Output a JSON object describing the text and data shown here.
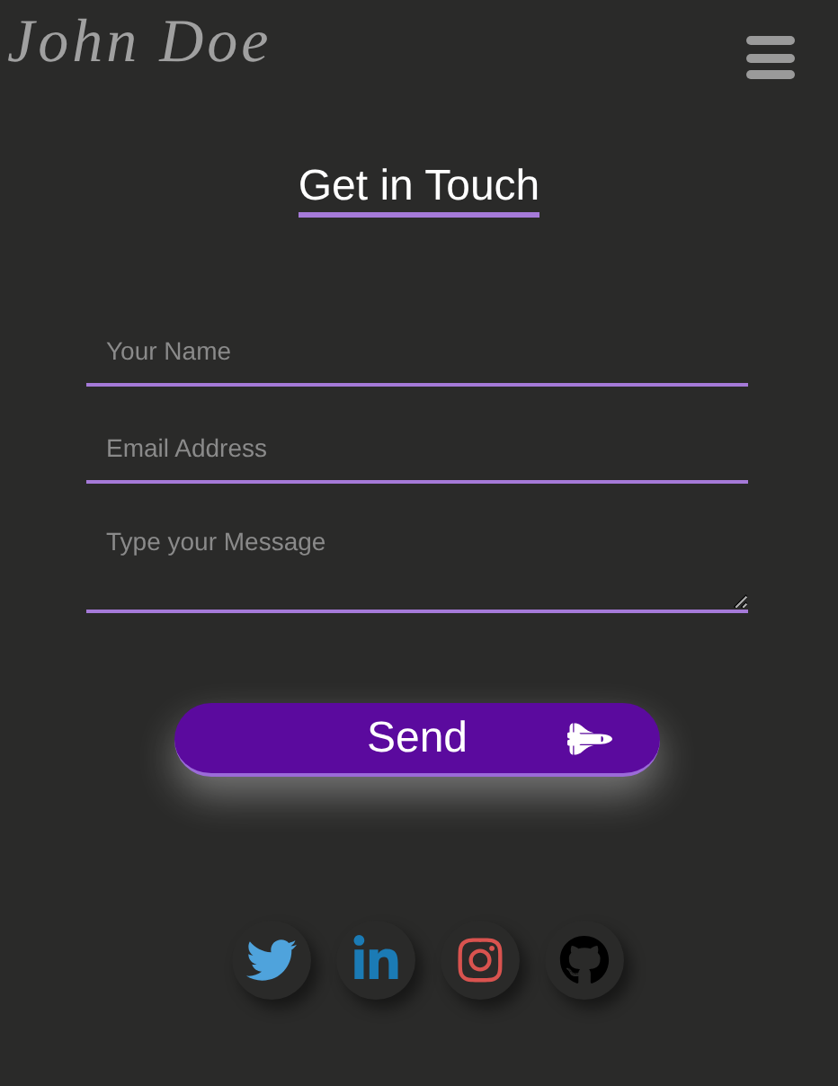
{
  "header": {
    "logo": "John Doe"
  },
  "title": "Get in Touch",
  "form": {
    "fields": [
      {
        "kind": "input",
        "placeholder": "Your Name"
      },
      {
        "kind": "input",
        "placeholder": "Email Address"
      },
      {
        "kind": "textarea",
        "placeholder": "Type your Message"
      }
    ],
    "submit": "Send"
  },
  "socials": [
    {
      "kind": "twitter",
      "color": "#4fa3dc"
    },
    {
      "kind": "linkedin",
      "color": "#1b7bb5"
    },
    {
      "kind": "instagram",
      "color": "#d9534f"
    },
    {
      "kind": "github",
      "color": "#000000"
    }
  ]
}
